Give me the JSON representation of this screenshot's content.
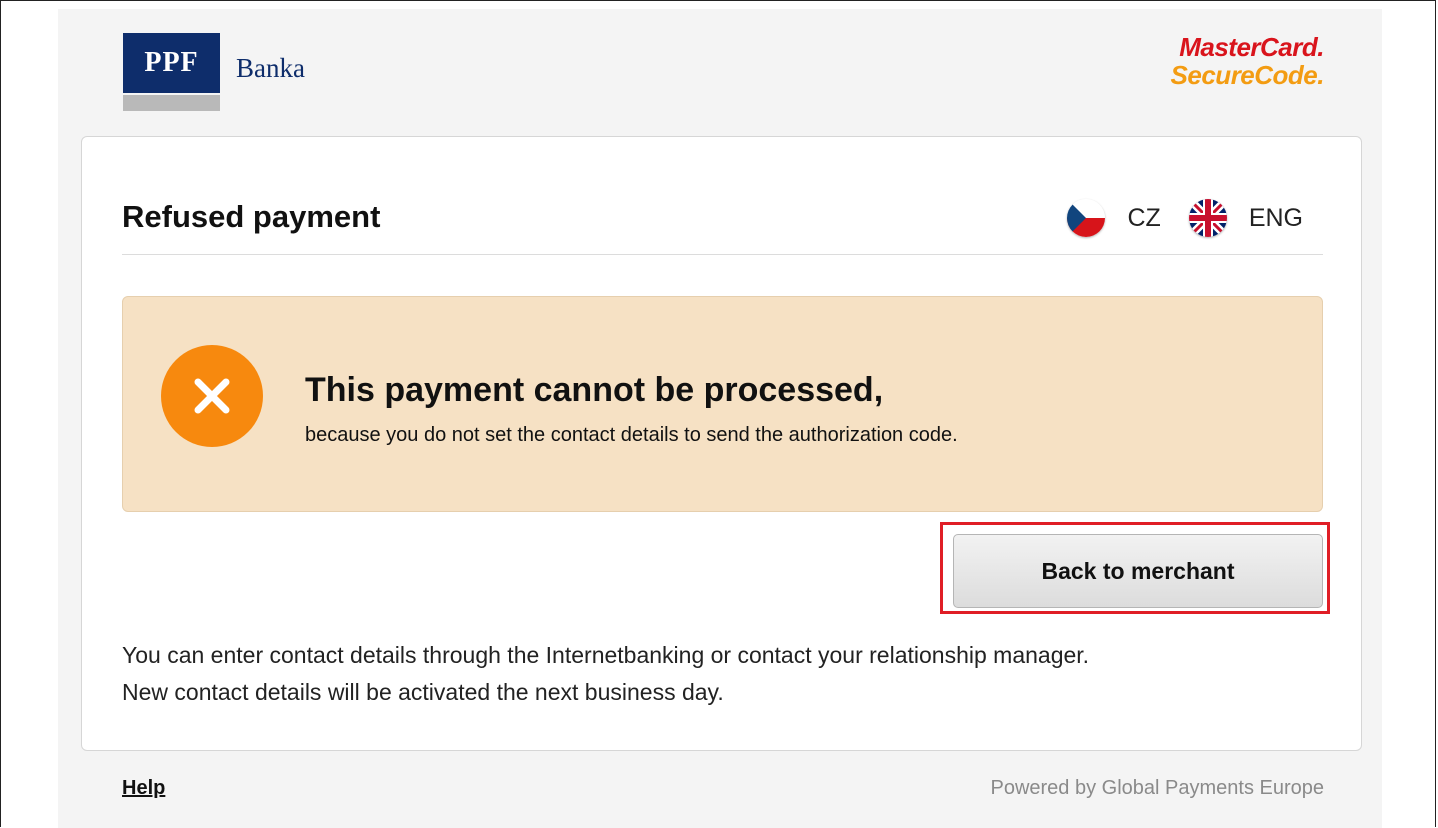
{
  "header": {
    "bank_logo_text": "PPF",
    "bank_name": "Banka",
    "card_brand_line1": "MasterCard.",
    "card_brand_line2": "SecureCode."
  },
  "card": {
    "title": "Refused payment",
    "languages": [
      {
        "code": "CZ",
        "icon": "czech-flag-icon"
      },
      {
        "code": "ENG",
        "icon": "uk-flag-icon"
      }
    ],
    "alert": {
      "icon": "close-icon",
      "title": "This payment cannot be processed,",
      "text": "because you do not set the contact details to send the authorization code."
    },
    "back_button_label": "Back to merchant",
    "info_lines": [
      "You can enter contact details through the Internetbanking or contact your relationship manager.",
      "New contact details will be activated the next business day."
    ]
  },
  "footer": {
    "help_label": "Help",
    "powered_by": "Powered by Global Payments Europe"
  },
  "colors": {
    "bank_navy": "#0e2d6b",
    "alert_bg": "#f6e1c4",
    "alert_icon": "#f7890e",
    "highlight_outline": "#e01e26",
    "mc_red": "#d9141c",
    "mc_orange": "#f39c12"
  }
}
